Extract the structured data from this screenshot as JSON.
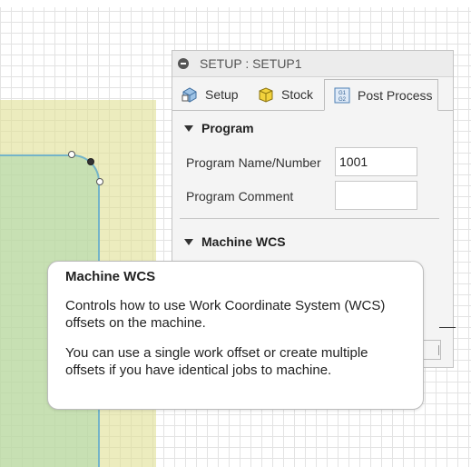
{
  "dialog": {
    "title": "SETUP : SETUP1",
    "tabs": [
      {
        "label": "Setup",
        "icon": "setup-icon"
      },
      {
        "label": "Stock",
        "icon": "stock-box-icon"
      },
      {
        "label": "Post Process",
        "icon": "g1-g2-icon",
        "active": true
      }
    ],
    "program_section": {
      "title": "Program",
      "name_label": "Program Name/Number",
      "name_value": "1001",
      "comment_label": "Program Comment",
      "comment_value": ""
    },
    "wcs_section": {
      "title": "Machine WCS"
    }
  },
  "tooltip": {
    "title": "Machine WCS",
    "paragraph1": "Controls how to use Work Coordinate System (WCS) offsets on the machine.",
    "paragraph2": "You can use a single work offset or create multiple offsets if you have identical jobs to machine."
  },
  "icon_texts": {
    "g1_line1": "G1",
    "g1_line2": "G2"
  },
  "colors": {
    "stock": "#e1e196",
    "part": "#aad7aa",
    "part_edge": "#74b4c8",
    "panel_bg": "#f4f4f4"
  }
}
